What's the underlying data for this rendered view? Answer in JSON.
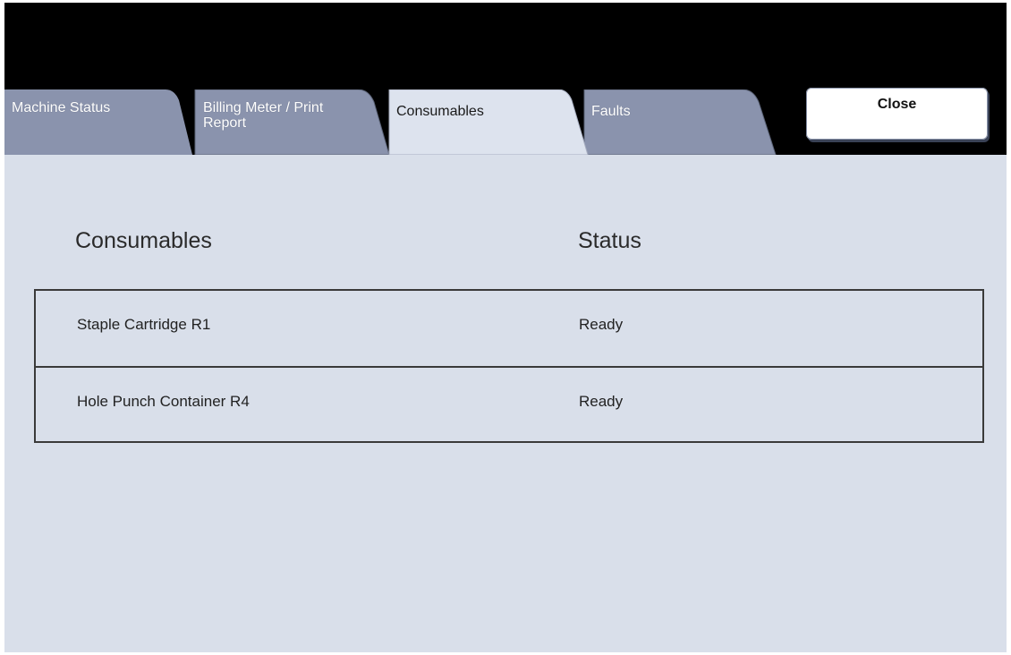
{
  "tabs": [
    {
      "label_line1": "Machine Status",
      "label_line2": ""
    },
    {
      "label_line1": "Billing Meter / Print",
      "label_line2": "Report"
    },
    {
      "label_line1": "Consumables",
      "label_line2": ""
    },
    {
      "label_line1": "Faults",
      "label_line2": ""
    }
  ],
  "active_tab": "Consumables",
  "close_label": "Close",
  "table": {
    "headers": {
      "consumable": "Consumables",
      "status": "Status"
    },
    "rows": [
      {
        "name": "Staple Cartridge R1",
        "status": "Ready"
      },
      {
        "name": "Hole Punch Container R4",
        "status": "Ready"
      }
    ]
  },
  "colors": {
    "tab_inactive": "#8a93ad",
    "tab_active": "#dde3ee",
    "panel": "#d9dfea",
    "frame": "#000000"
  }
}
